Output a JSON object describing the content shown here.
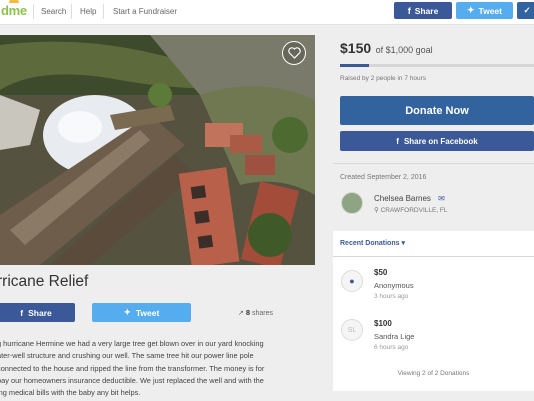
{
  "header": {
    "logo_text": "dme",
    "nav": [
      "Search",
      "Help",
      "Start a Fundraiser"
    ],
    "share_label": "Share",
    "tweet_label": "Tweet",
    "check_label": "✓"
  },
  "colors": {
    "facebook": "#3b5998",
    "twitter": "#55acee",
    "donate": "#33639e",
    "logo_green": "#8fc04f"
  },
  "campaign": {
    "title": "rricane Relief",
    "photo_alt": "Fallen tree on brick wall and water heater",
    "heart_icon": "heart-icon",
    "share_label": "Share",
    "tweet_label": "Tweet",
    "shares_count": "8",
    "shares_label": "shares",
    "story_lines": [
      "g hurricane Hermine we had a very large tree get blown over in our yard knocking",
      "ater-well structure and crushing our well. The same tree hit our power line pole",
      "connected to the house and ripped the line from the transformer. The money is for",
      "pay our homeowners insurance deductible. We just replaced the well and with the",
      "ing medical bills with the baby any bit helps."
    ]
  },
  "fundraiser": {
    "raised": "$150",
    "goal_text": "of $1,000 goal",
    "progress": 0.15,
    "raised_by": "Raised by 2 people in 7 hours",
    "donate_label": "Donate Now",
    "fb_share_label": "Share on Facebook",
    "created": "Created September 2, 2016",
    "organizer_name": "Chelsea Barnes",
    "organizer_location": "CRAWFORDVILLE, FL"
  },
  "donations": {
    "header": "Recent Donations",
    "items": [
      {
        "amount": "$50",
        "name": "Anonymous",
        "time": "3 hours ago"
      },
      {
        "amount": "$100",
        "name": "Sandra Lige",
        "time": "6 hours ago"
      }
    ],
    "footer": "Viewing 2 of 2 Donations"
  }
}
